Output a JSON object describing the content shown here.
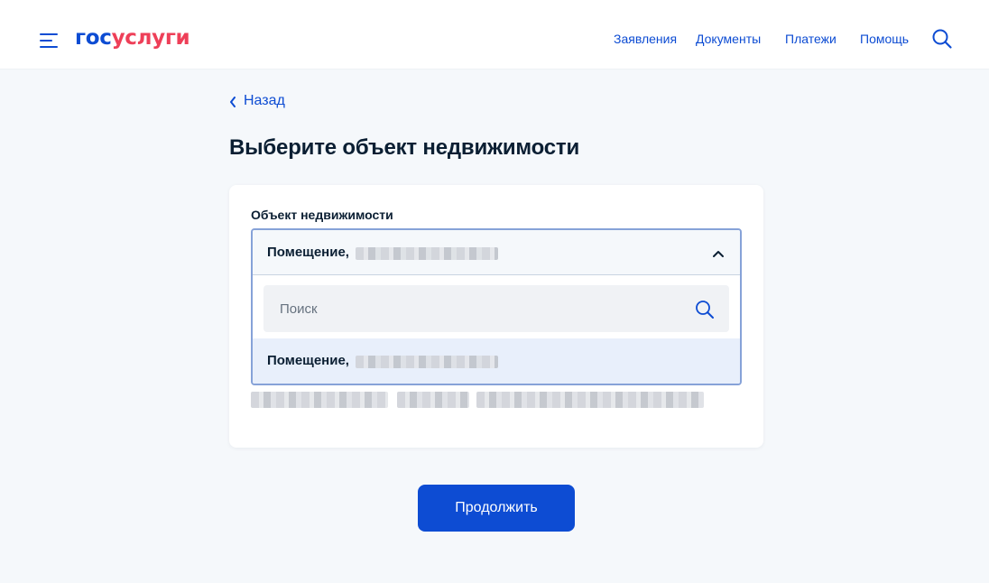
{
  "header": {
    "logo_part1": "гос",
    "logo_part2": "услуги",
    "nav": [
      "Заявления",
      "Документы",
      "Платежи",
      "Помощь"
    ]
  },
  "back_label": "Назад",
  "page_title": "Выберите объект недвижимости",
  "form": {
    "field_label": "Объект недвижимости",
    "selected_value": "Помещение,",
    "search_placeholder": "Поиск",
    "options": [
      "Помещение,"
    ]
  },
  "continue_label": "Продолжить",
  "colors": {
    "brand_blue": "#0d4cd3",
    "brand_red": "#ee3f58",
    "page_bg": "#f5f8fb",
    "option_highlight": "#e8effb"
  },
  "icons": [
    "menu-icon",
    "search-icon",
    "chevron-left-icon",
    "chevron-up-icon"
  ]
}
